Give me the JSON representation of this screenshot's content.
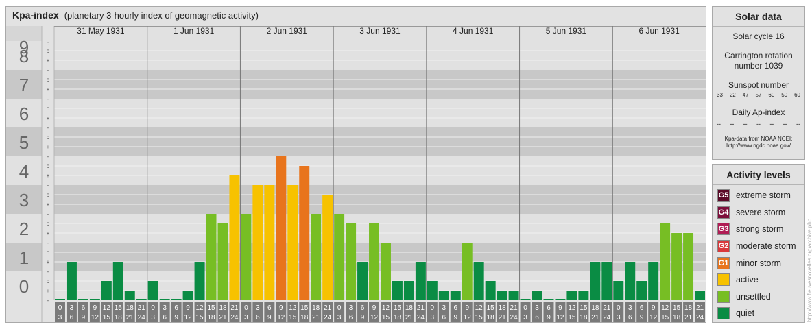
{
  "header": {
    "title": "Kpa-index",
    "subtitle": "(planetary 3-hourly index of geomagnetic activity)"
  },
  "chart_data": {
    "type": "bar",
    "title": "Kpa-index",
    "subtitle": "(planetary 3-hourly index of geomagnetic activity)",
    "ylim": [
      0,
      9
    ],
    "y_ticks": [
      "0",
      "1",
      "2",
      "3",
      "4",
      "5",
      "6",
      "7",
      "8",
      "9"
    ],
    "sub_ticks": [
      "-",
      "+",
      "o"
    ],
    "days": [
      "31 May 1931",
      "1 Jun 1931",
      "2 Jun 1931",
      "3 Jun 1931",
      "4 Jun 1931",
      "5 Jun 1931",
      "6 Jun 1931"
    ],
    "interval_start": [
      "0",
      "3",
      "6",
      "9",
      "12",
      "15",
      "18",
      "21"
    ],
    "interval_end": [
      "3",
      "6",
      "9",
      "12",
      "15",
      "18",
      "21",
      "24"
    ],
    "values": [
      0,
      1.333,
      0,
      0,
      0.667,
      1.333,
      0.333,
      0,
      0.667,
      0,
      0,
      0.333,
      1.333,
      3,
      2.667,
      4.333,
      3,
      4,
      4,
      5,
      4,
      4.667,
      3,
      3.667,
      3,
      2.667,
      1.333,
      2.667,
      2,
      0.667,
      0.667,
      1.333,
      0.667,
      0.333,
      0.333,
      2,
      1.333,
      0.667,
      0.333,
      0.333,
      0,
      0.333,
      0,
      0,
      0.333,
      0.333,
      1.333,
      1.333,
      0.667,
      1.333,
      0.667,
      1.333,
      2.667,
      2.333,
      2.333,
      0.333
    ],
    "color_scale": [
      {
        "level": "quiet",
        "max": 1.667,
        "color": "#0a8c44"
      },
      {
        "level": "unsettled",
        "max": 3.333,
        "color": "#77be24"
      },
      {
        "level": "active",
        "max": 4.333,
        "color": "#f7c200"
      },
      {
        "level": "minor storm",
        "max": 5.333,
        "color": "#e8741c"
      }
    ],
    "grid": true
  },
  "solar": {
    "title": "Solar data",
    "cycle": "Solar cycle 16",
    "carrington_1": "Carrington rotation",
    "carrington_2": "number 1039",
    "sunspot_title": "Sunspot number",
    "sunspots": [
      "33",
      "22",
      "47",
      "57",
      "60",
      "50",
      "60"
    ],
    "ap_title": "Daily Ap-index",
    "ap_values": [
      "--",
      "--",
      "--",
      "--",
      "--",
      "--",
      "--"
    ],
    "source_1": "Kpa-data from NOAA NCEI:",
    "source_2": "http://www.ngdc.noaa.gov/"
  },
  "activity": {
    "title": "Activity levels",
    "items": [
      {
        "badge": "G5",
        "label": "extreme storm",
        "color": "#5a0a28"
      },
      {
        "badge": "G4",
        "label": "severe storm",
        "color": "#7d0e3b"
      },
      {
        "badge": "G3",
        "label": "strong storm",
        "color": "#b01d55"
      },
      {
        "badge": "G2",
        "label": "moderate storm",
        "color": "#d9393c"
      },
      {
        "badge": "G1",
        "label": "minor storm",
        "color": "#e8741c"
      },
      {
        "badge": "",
        "label": "active",
        "color": "#f7c200"
      },
      {
        "badge": "",
        "label": "unsettled",
        "color": "#77be24"
      },
      {
        "badge": "",
        "label": "quiet",
        "color": "#0a8c44"
      }
    ]
  },
  "watermark": "http://www.fleuvesnovelles.org/archive.php"
}
